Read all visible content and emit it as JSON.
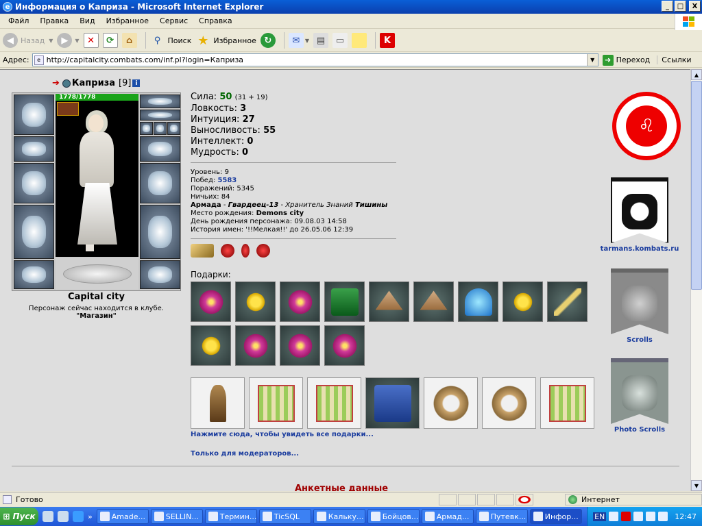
{
  "window": {
    "title": "Информация о Каприза - Microsoft Internet Explorer",
    "controls": [
      "_",
      "□",
      "X"
    ]
  },
  "menu": [
    "Файл",
    "Правка",
    "Вид",
    "Избранное",
    "Сервис",
    "Справка"
  ],
  "toolbar": {
    "back": "Назад",
    "search": "Поиск",
    "favorites": "Избранное"
  },
  "address": {
    "label": "Адрес:",
    "url": "http://capitalcity.combats.com/inf.pl?login=Каприза",
    "go": "Переход",
    "links": "Ссылки"
  },
  "character": {
    "nick": "Каприза",
    "level": "[9]",
    "hp": "1778/1778",
    "city": "Capital city",
    "location_text": "Персонаж сейчас находится в клубе.",
    "club": "\"Магазин\""
  },
  "stats": {
    "strength_label": "Сила:",
    "strength": "50",
    "strength_extra": "(31 + 19)",
    "agility_label": "Ловкость:",
    "agility": "3",
    "intuition_label": "Интуиция:",
    "intuition": "27",
    "endurance_label": "Выносливость:",
    "endurance": "55",
    "intellect_label": "Интеллект:",
    "intellect": "0",
    "wisdom_label": "Мудрость:",
    "wisdom": "0"
  },
  "info": {
    "level_label": "Уровень:",
    "level": "9",
    "wins_label": "Побед:",
    "wins": "5583",
    "losses_label": "Поражений:",
    "losses": "5345",
    "draws_label": "Ничьих:",
    "draws": "84",
    "army": "Армада",
    "rank": "Гвардеец-13",
    "title_pre": "Хранитель Знаний",
    "title_post": "Тишины",
    "birthplace_label": "Место рождения:",
    "birthplace": "Demons city",
    "birthday_label": "День рождения персонажа:",
    "birthday": "09.08.03 14:58",
    "names_history": "История имен: '!!Мелкая!!' до 26.05.06 12:39"
  },
  "gifts": {
    "label": "Подарки:",
    "see_all": "Нажмите сюда, чтобы увидеть все подарки...",
    "moderators": "Только для модераторов...",
    "icons": [
      "flower",
      "rose",
      "flower",
      "cape",
      "hat",
      "hat",
      "mush",
      "rose",
      "wand",
      "rose",
      "flower",
      "flower",
      "flower"
    ],
    "big_icons": [
      "statue",
      "box",
      "box",
      "jar",
      "basket",
      "basket",
      "box"
    ]
  },
  "section": {
    "anketa": "Анкетные данные"
  },
  "banners": {
    "tarmans": "tarmans.kombats.ru",
    "scrolls": "Scrolls",
    "photo_scrolls": "Photo Scrolls"
  },
  "statusbar": {
    "ready": "Готово",
    "zone": "Интернет"
  },
  "taskbar": {
    "start": "Пуск",
    "tasks": [
      "Amade...",
      "SELLIN...",
      "Термин...",
      "TicSQL",
      "Кальку...",
      "Бойцов...",
      "Армад...",
      "Путевк...",
      "Инфор..."
    ],
    "lang": "EN",
    "clock": "12:47"
  },
  "colors": {
    "hp_bar": "#1aa31a",
    "stat_value": "#006600",
    "link": "#1a3c9e",
    "section_heading": "#a00000"
  }
}
